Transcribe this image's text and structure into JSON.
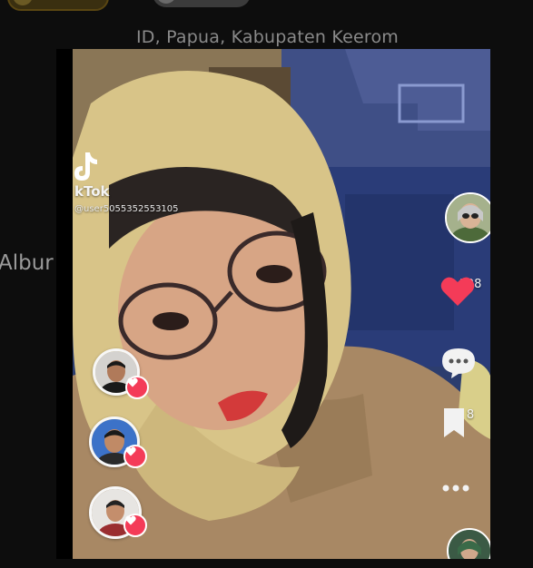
{
  "header": {
    "location": "ID, Papua, Kabupaten Keerom"
  },
  "sidebar": {
    "label_fragment": "Albur"
  },
  "video": {
    "watermark_brand": "kTok",
    "watermark_user": "@user5055352553105",
    "like_count": "128",
    "save_count": "8"
  },
  "colors": {
    "like_red": "#f43b58",
    "background": "#0d0d0d",
    "caption_gray": "#8a8a8a"
  },
  "icons": {
    "like": "heart-icon",
    "comment": "comment-bubble-icon",
    "save": "bookmark-icon",
    "more": "more-dots-icon",
    "watermark": "tiktok-logo-icon"
  }
}
